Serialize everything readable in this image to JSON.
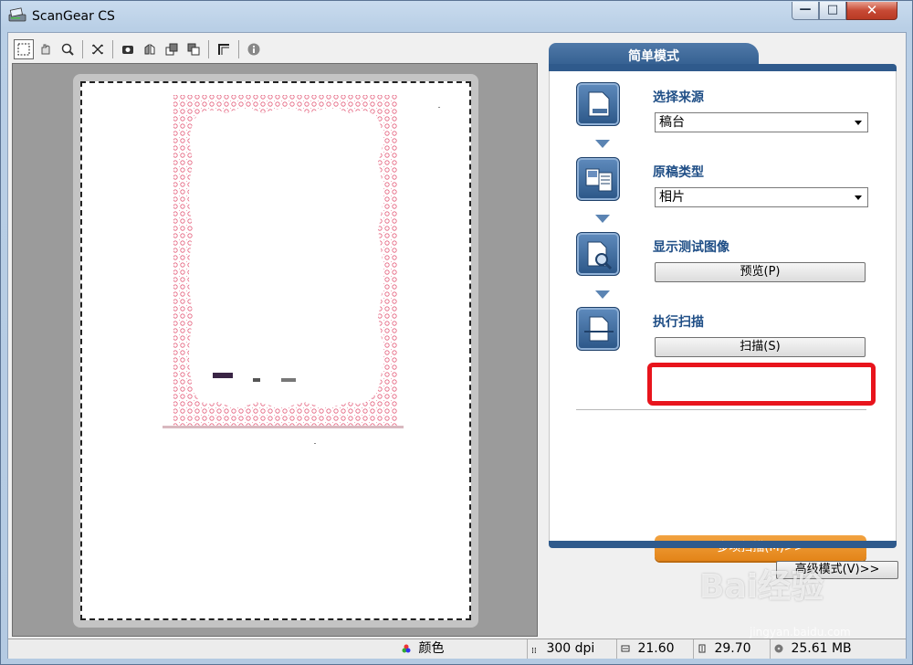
{
  "window": {
    "title": "ScanGear CS"
  },
  "title_buttons": {
    "minimize": "—",
    "maximize": "□",
    "close": "✕"
  },
  "toolbar": {
    "items": [
      "select-area",
      "rotate",
      "zoom",
      "auto-crop",
      "color-mode",
      "mirror",
      "clone",
      "frame",
      "crop",
      "info"
    ]
  },
  "panel": {
    "tab": "简单模式",
    "steps": [
      {
        "label": "选择来源",
        "value": "稿台"
      },
      {
        "label": "原稿类型",
        "value": "相片"
      },
      {
        "label": "显示测试图像",
        "button": "预览(P)"
      },
      {
        "label": "执行扫描",
        "button": "扫描(S)"
      }
    ],
    "multi_scan_button": "多项扫描(M)>>"
  },
  "advanced_button": "高级模式(V)>>",
  "status": {
    "color": "颜色",
    "resolution": "300 dpi",
    "width": "21.60",
    "height": "29.70",
    "size": "25.61 MB"
  },
  "watermark": {
    "text": "Bai经验",
    "sub": "jingyan.baidu.com"
  },
  "colors": {
    "accent": "#2f5a8c",
    "highlight": "#e8141c",
    "orange": "#e38418"
  }
}
